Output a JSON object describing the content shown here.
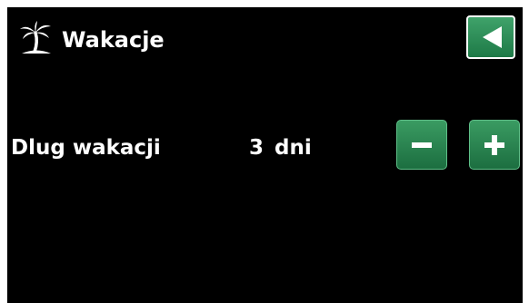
{
  "header": {
    "title": "Wakacje",
    "icon": "palm-tree-icon"
  },
  "setting": {
    "label": "Dlug wakacji",
    "value": "3",
    "unit": "dni"
  },
  "controls": {
    "back_icon": "back-arrow-icon",
    "decrease_icon": "minus-icon",
    "increase_icon": "plus-icon"
  },
  "colors": {
    "background": "#000000",
    "text": "#ffffff",
    "button_green": "#2a8a55"
  }
}
